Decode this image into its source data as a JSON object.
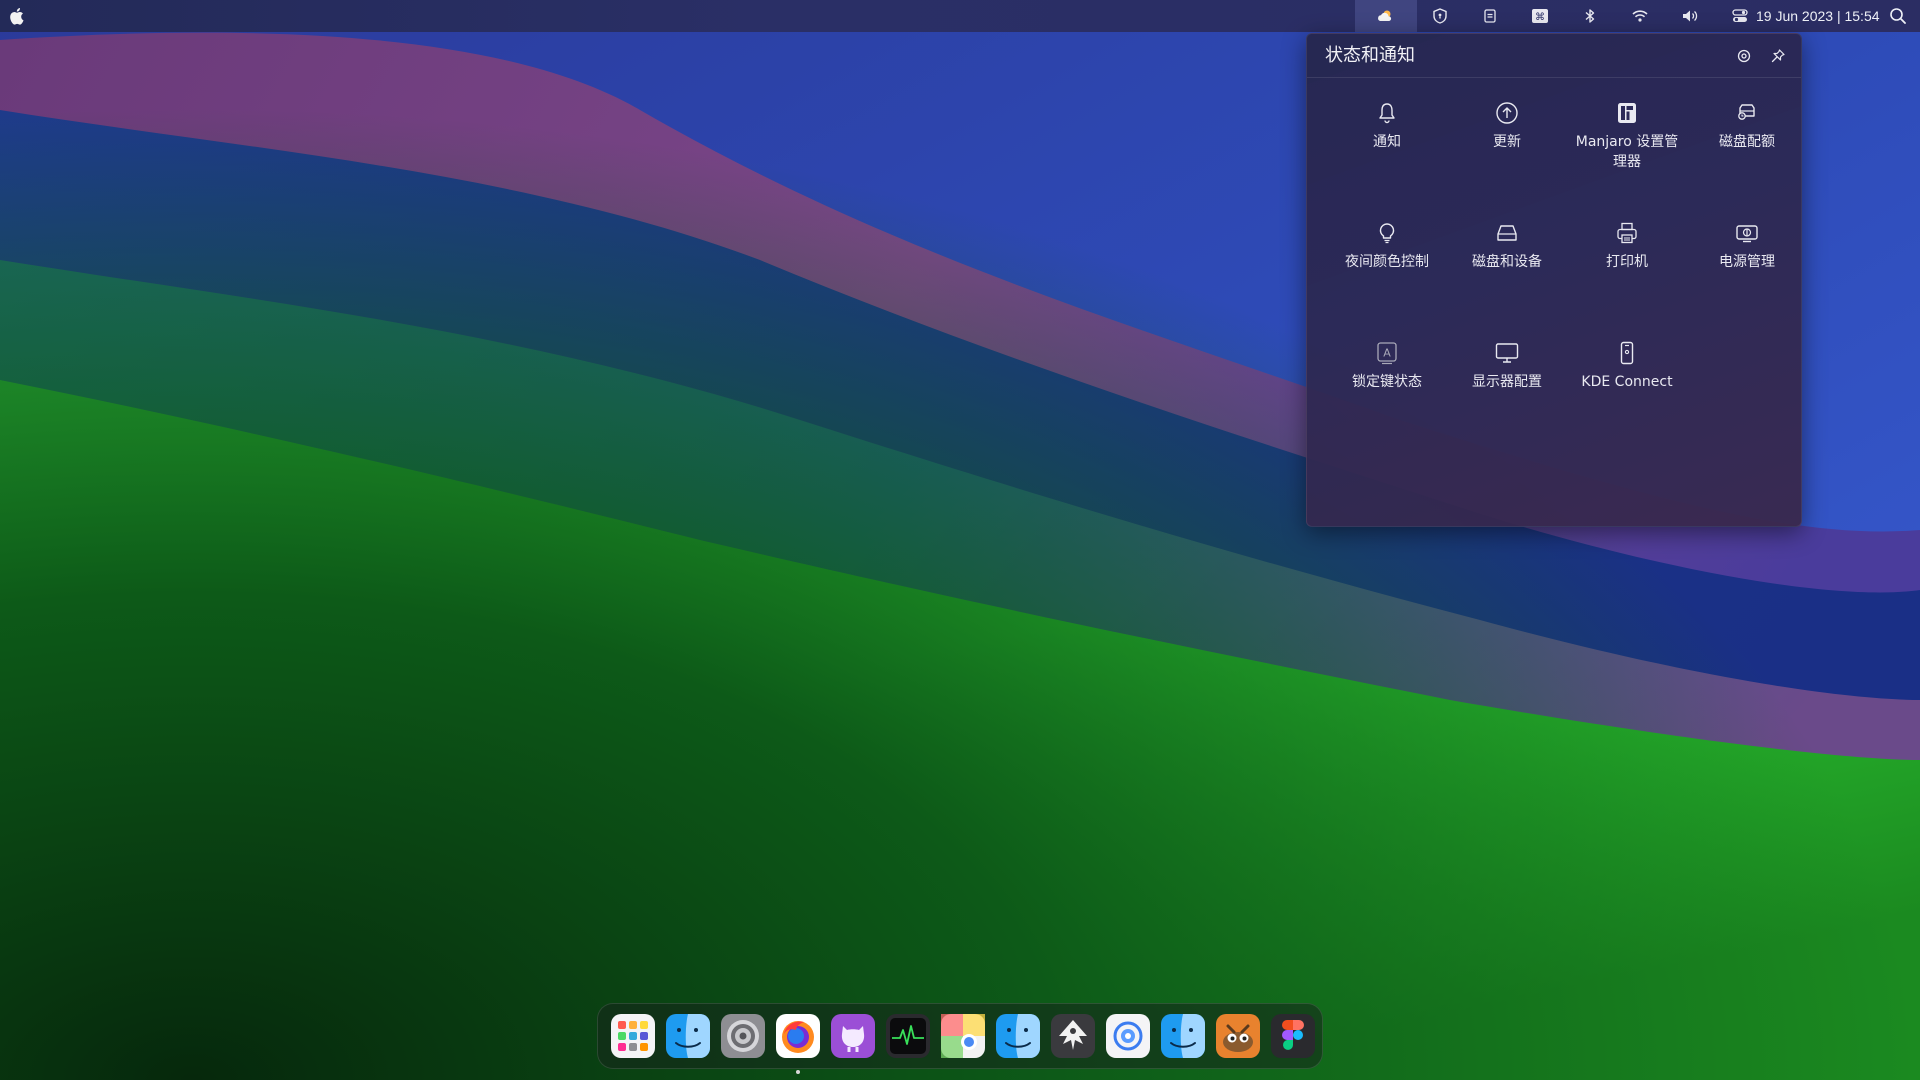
{
  "menubar": {
    "clock": "19 Jun 2023 | 15:54",
    "tray_icons": [
      {
        "name": "weather-icon"
      },
      {
        "name": "shield-icon"
      },
      {
        "name": "clipboard-icon"
      },
      {
        "name": "input-method-icon"
      },
      {
        "name": "bluetooth-icon"
      },
      {
        "name": "wifi-icon"
      },
      {
        "name": "volume-icon"
      },
      {
        "name": "control-center-icon"
      }
    ]
  },
  "popup": {
    "title": "状态和通知",
    "items": [
      {
        "label": "通知",
        "icon": "bell-icon"
      },
      {
        "label": "更新",
        "icon": "update-icon"
      },
      {
        "label": "Manjaro 设置管理器",
        "icon": "manjaro-icon"
      },
      {
        "label": "磁盘配额",
        "icon": "disk-quota-icon"
      },
      {
        "label": "夜间颜色控制",
        "icon": "night-color-icon"
      },
      {
        "label": "磁盘和设备",
        "icon": "drive-icon"
      },
      {
        "label": "打印机",
        "icon": "printer-icon"
      },
      {
        "label": "电源管理",
        "icon": "battery-icon"
      },
      {
        "label": "锁定键状态",
        "icon": "lock-keys-icon"
      },
      {
        "label": "显示器配置",
        "icon": "monitor-icon"
      },
      {
        "label": "KDE Connect",
        "icon": "phone-icon"
      }
    ]
  },
  "dock": {
    "apps": [
      {
        "icon": "launchpad-icon"
      },
      {
        "icon": "finder-icon"
      },
      {
        "icon": "system-settings-icon"
      },
      {
        "icon": "firefox-icon"
      },
      {
        "icon": "github-icon"
      },
      {
        "icon": "activity-monitor-icon"
      },
      {
        "icon": "chrome-icon"
      },
      {
        "icon": "finder-icon"
      },
      {
        "icon": "inkscape-icon"
      },
      {
        "icon": "web-browser-icon"
      },
      {
        "icon": "finder-icon"
      },
      {
        "icon": "gimp-icon"
      },
      {
        "icon": "figma-icon"
      }
    ]
  }
}
